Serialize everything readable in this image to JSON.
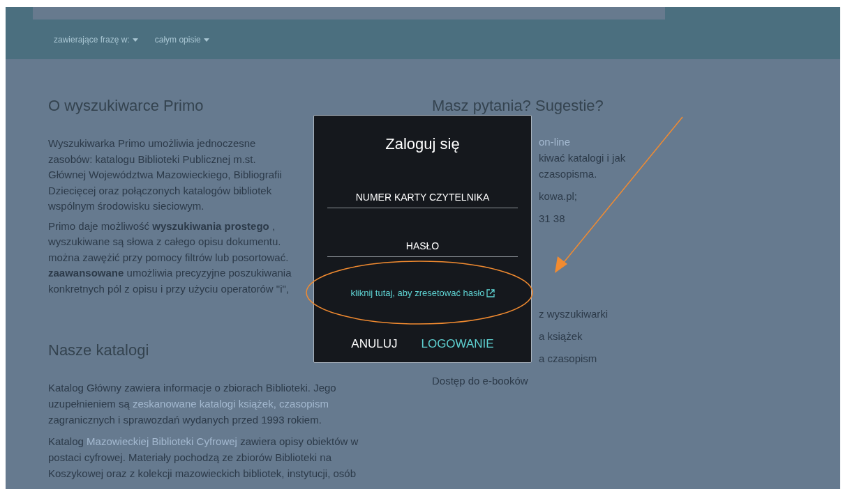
{
  "search_bar": {
    "filters": [
      {
        "label": "zawierające frazę w:"
      },
      {
        "label": "całym opisie"
      }
    ]
  },
  "left_column": {
    "intro_heading": "O wyszukiwarce Primo",
    "intro_paragraphs": [
      [
        "Wyszukiwarka Primo umożliwia jednoczesne",
        "zasobów: katalogu Biblioteki Publicznej m.st.",
        "Głównej Województwa Mazowieckiego, Bibliografii",
        "Dziecięcej oraz połączonych katalogów bibliotek",
        "wspólnym środowisku sieciowym."
      ],
      [
        "Primo daje możliwość **wyszukiwania prostego** ,",
        "wyszukiwane są słowa z całego opisu dokumentu.",
        "można zawężić przy pomocy filtrów lub posortować.",
        "**zaawansowane** umożliwia precyzyjne poszukiwania",
        "konkretnych pól z opisu i przy użyciu operatorów \"i\","
      ]
    ],
    "catalog_heading": "Nasze katalogi",
    "catalog_paragraphs": [
      [
        {
          "text": "Katalog Główny zawiera informacje o zbiorach Biblioteki. Jego uzupełnieniem są",
          "link": false
        },
        {
          "text": "zeskanowane katalogi książek, czasopism",
          "link": true
        },
        {
          "text": "zagranicznych i sprawozdań wydanych przed 1993 rokiem.",
          "link": false
        }
      ],
      [
        {
          "text": "Katalog",
          "link": false
        },
        {
          "text": "Mazowieckiej Biblioteki Cyfrowej",
          "link": true
        },
        {
          "text": "zawiera opisy obiektów w postaci cyfrowej. Materiały pochodzą ze zbiorów Biblioteki na Koszykowej oraz z kolekcji mazowieckich bibliotek, instytucji, osób",
          "link": false
        }
      ]
    ]
  },
  "right_column": {
    "heading": "Masz pytania? Sugestie?",
    "contact_groups": [
      [
        {
          "text": "on-line",
          "link": true
        },
        {
          "text": "kiwać katalogi i jak",
          "link": false
        },
        {
          "text": "czasopisma.",
          "link": false
        }
      ],
      [
        {
          "text": "kowa.pl;",
          "link": false
        }
      ],
      [
        {
          "text": "31 38",
          "link": false
        }
      ]
    ],
    "info_partial_links": [
      "z wyszukiwarki",
      "a książek",
      "a czasopism"
    ],
    "info_links": [
      "Dostęp do e-booków"
    ]
  },
  "dialog": {
    "title": "Zaloguj się",
    "fields": [
      {
        "placeholder": "NUMER KARTY CZYTELNIKA"
      },
      {
        "placeholder": "HASŁO"
      }
    ],
    "reset_link": "kliknij tutaj, aby zresetować hasło",
    "buttons": [
      {
        "label": "ANULUJ",
        "primary": false
      },
      {
        "label": "LOGOWANIE",
        "primary": true
      }
    ]
  }
}
